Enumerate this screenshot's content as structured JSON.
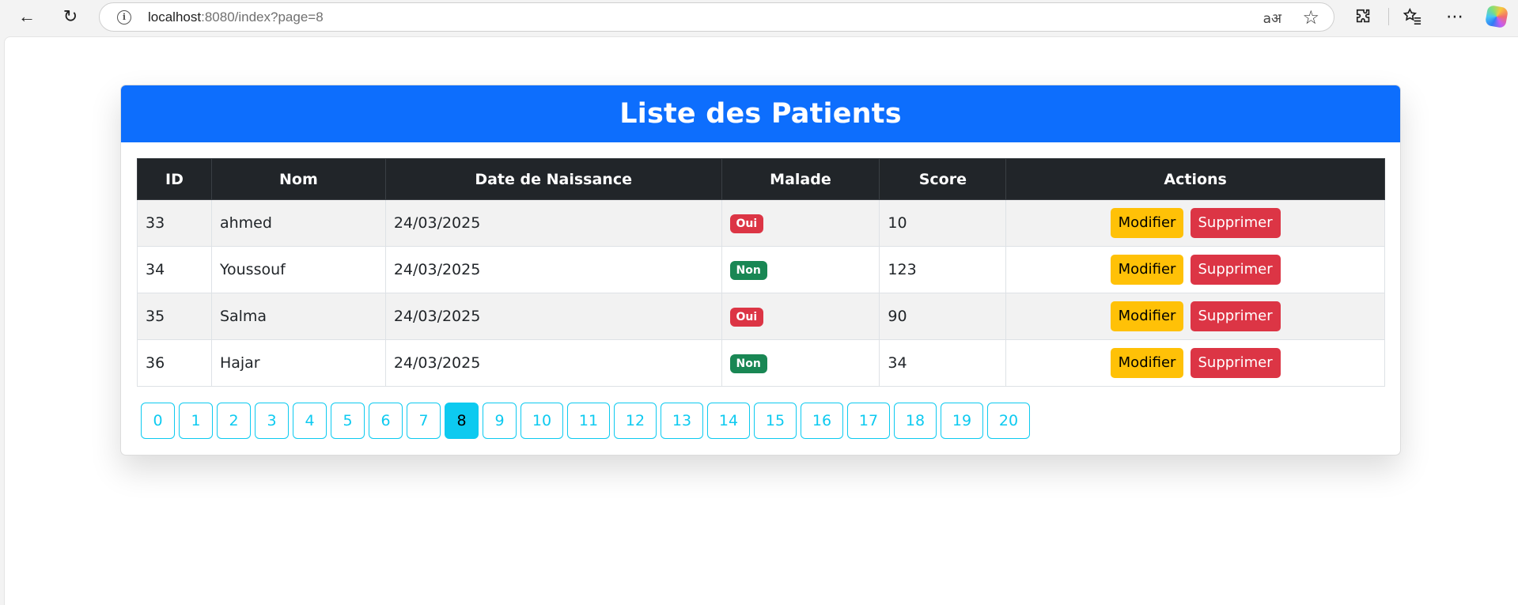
{
  "browser": {
    "url_host": "localhost",
    "url_rest": ":8080/index?page=8",
    "read_aloud_glyph": "aअ",
    "back_glyph": "←",
    "refresh_glyph": "↻",
    "star_glyph": "☆",
    "more_glyph": "⋯",
    "favorites_glyph": "★",
    "extensions_glyph": "⚙"
  },
  "page": {
    "title": "Liste des Patients",
    "columns": [
      "ID",
      "Nom",
      "Date de Naissance",
      "Malade",
      "Score",
      "Actions"
    ],
    "rows": [
      {
        "id": "33",
        "nom": "ahmed",
        "date": "24/03/2025",
        "malade": "Oui",
        "score": "10"
      },
      {
        "id": "34",
        "nom": "Youssouf",
        "date": "24/03/2025",
        "malade": "Non",
        "score": "123"
      },
      {
        "id": "35",
        "nom": "Salma",
        "date": "24/03/2025",
        "malade": "Oui",
        "score": "90"
      },
      {
        "id": "36",
        "nom": "Hajar",
        "date": "24/03/2025",
        "malade": "Non",
        "score": "34"
      }
    ],
    "edit_label": "Modifier",
    "delete_label": "Supprimer",
    "pages": [
      "0",
      "1",
      "2",
      "3",
      "4",
      "5",
      "6",
      "7",
      "8",
      "9",
      "10",
      "11",
      "12",
      "13",
      "14",
      "15",
      "16",
      "17",
      "18",
      "19",
      "20"
    ],
    "current_page": "8"
  },
  "colors": {
    "header": "#0d6efd",
    "table_head": "#212529",
    "yes_badge": "#dc3545",
    "no_badge": "#198754",
    "edit_button": "#ffc107",
    "delete_button": "#dc3545",
    "pager": "#0dcaf0"
  }
}
